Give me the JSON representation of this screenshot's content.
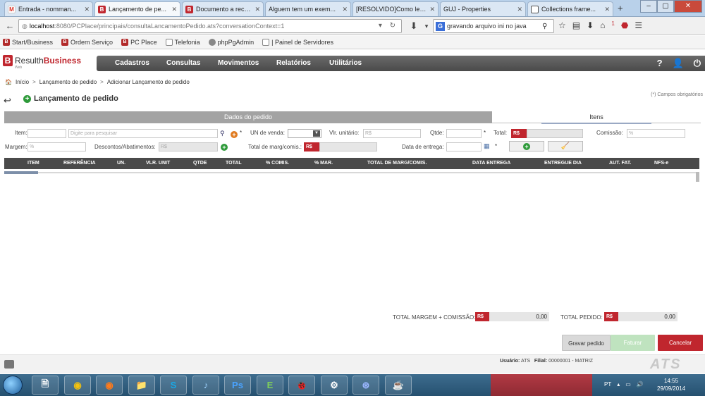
{
  "browser": {
    "tabs": [
      {
        "label": "Entrada - nomman...",
        "icon": "gmail-icon",
        "active": false
      },
      {
        "label": "Lançamento de pe...",
        "icon": "resulth-icon",
        "active": true
      },
      {
        "label": "Documento a rece...",
        "icon": "resulth-icon",
        "active": false
      },
      {
        "label": "Alguem tem um exem...",
        "icon": "none",
        "active": false
      },
      {
        "label": "[RESOLVIDO]Como ler ...",
        "icon": "none",
        "active": false
      },
      {
        "label": "GUJ - Properties",
        "icon": "none",
        "active": false
      },
      {
        "label": "Collections frame...",
        "icon": "page-icon",
        "active": false
      }
    ],
    "url_host": "localhost",
    "url_path": ":8080/PCPlace/principais/consultaLancamentoPedido.ats?conversationContext=1",
    "search_value": "gravando arquivo ini no java",
    "search_engine": "G",
    "notification_count": "1",
    "bookmarks": [
      {
        "label": "Start/Business",
        "icon": "resulth-icon"
      },
      {
        "label": "Ordem Serviço",
        "icon": "resulth-icon"
      },
      {
        "label": "PC Place",
        "icon": "resulth-icon"
      },
      {
        "label": "Telefonia",
        "icon": "page-icon"
      },
      {
        "label": "phpPgAdmin",
        "icon": "php-icon"
      },
      {
        "label": "| Painel de Servidores",
        "icon": "page-icon"
      }
    ]
  },
  "app": {
    "logo_letter": "B",
    "logo_text_a": "Resulth",
    "logo_text_b": "Business",
    "logo_sub": "Web",
    "menu": [
      "Cadastros",
      "Consultas",
      "Movimentos",
      "Relatórios",
      "Utilitários"
    ],
    "breadcrumb": [
      "Início",
      "Lançamento de pedido",
      "Adicionar Lançamento de pedido"
    ],
    "page_title": "Lançamento de pedido",
    "required_note": "(*) Campos obrigatórios",
    "tabs": {
      "pedido": "Dados do pedido",
      "itens": "Itens"
    }
  },
  "form": {
    "item_label": "Item:",
    "item_placeholder": "Digite para pesquisar",
    "un_venda_label": "UN de venda:",
    "vlr_unitario_label": "Vlr. unitário:",
    "vlr_unitario_ph": "R$",
    "qtde_label": "Qtde:",
    "total_label": "Total:",
    "currency": "R$",
    "comissao_label": "Comissão:",
    "percent_ph": "%",
    "margem_label": "Margem:",
    "descontos_label": "Descontos/Abatimentos:",
    "total_marg_label": "Total de marg/comis.:",
    "data_entrega_label": "Data de entrega:",
    "required_mark": "*"
  },
  "table": {
    "columns": [
      "ITEM",
      "REFERÊNCIA",
      "UN.",
      "VLR. UNIT",
      "QTDE",
      "TOTAL",
      "% COMIS.",
      "% MAR.",
      "TOTAL DE MARG/COMIS.",
      "DATA ENTREGA",
      "ENTREGUE DIA",
      "AUT. FAT.",
      "NFS-e"
    ],
    "rows": []
  },
  "totals": {
    "margem_comissao_label": "TOTAL MARGEM + COMISSÃO:",
    "margem_comissao_value": "0,00",
    "pedido_label": "TOTAL PEDIDO:",
    "pedido_value": "0,00"
  },
  "buttons": {
    "gravar": "Gravar pedido",
    "faturar": "Faturar",
    "cancelar": "Cancelar"
  },
  "footer": {
    "usuario_label": "Usuário:",
    "usuario_value": "ATS",
    "filial_label": "Filial:",
    "filial_value": "00000001 - MATRIZ",
    "brand": "ATS"
  },
  "taskbar": {
    "apps": [
      "🗎",
      "◉",
      "◉",
      "📁",
      "S",
      "♪",
      "Ps",
      "E",
      "🐞",
      "⚙",
      "⊛",
      "☕"
    ],
    "language": "PT",
    "time": "14:55",
    "date": "29/09/2014"
  },
  "colors": {
    "brand_red": "#c0262e",
    "menubar": "#4a4a4a",
    "add_green": "#2e9a3a"
  }
}
